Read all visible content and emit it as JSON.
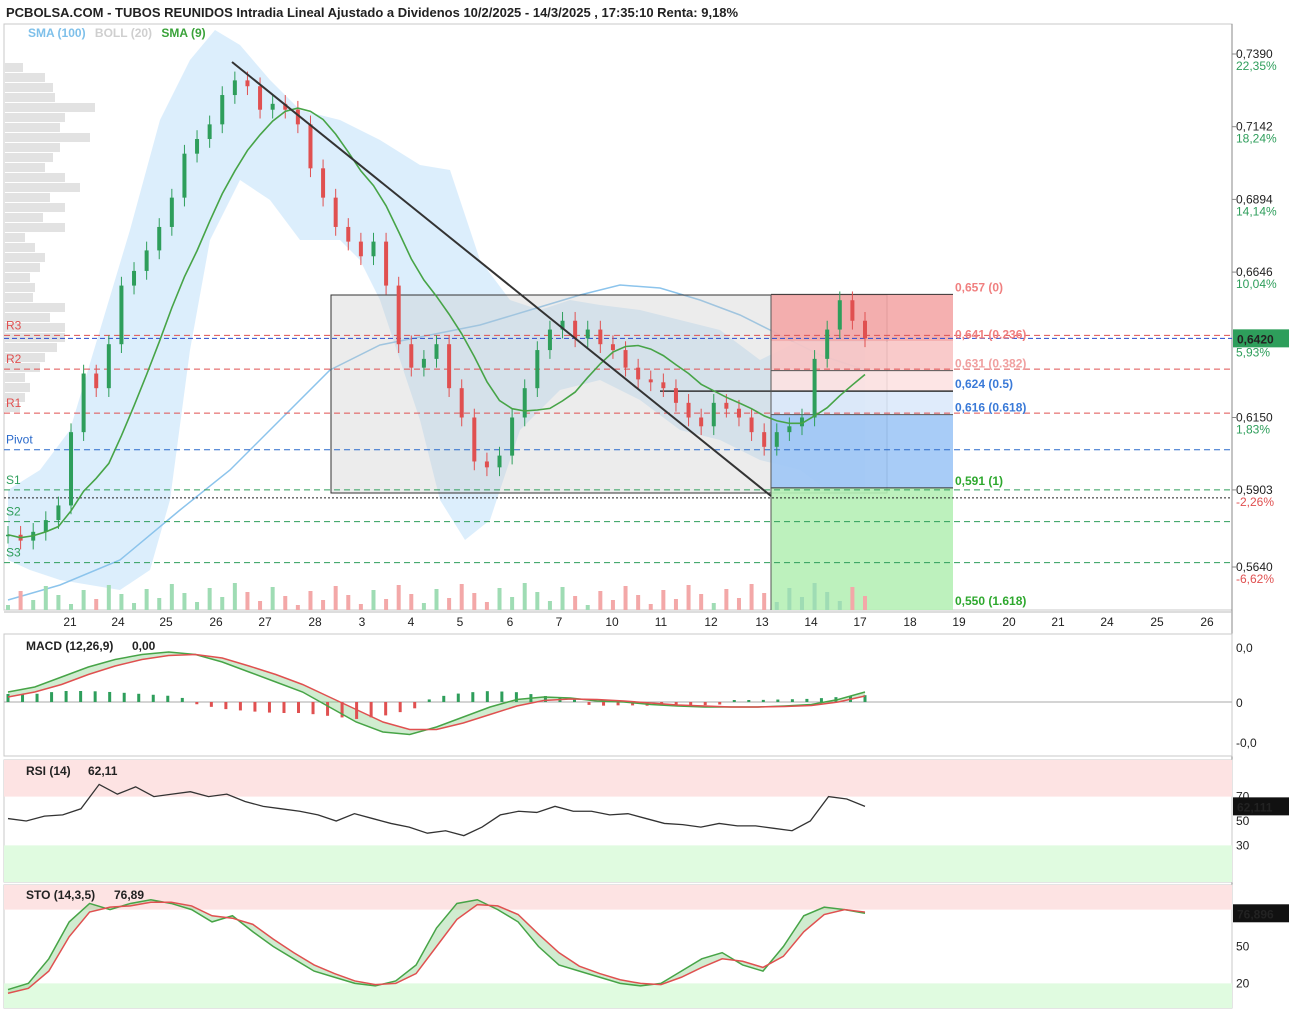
{
  "header": {
    "title": "PCBOLSA.COM - TUBOS REUNIDOS Intradia Lineal Ajustado a Dividenos 10/2/2025 - 14/3/2025 , 17:35:10 Renta: 9,18%"
  },
  "legend": [
    {
      "label": "SMA (100)",
      "color": "#6ab4e8"
    },
    {
      "label": "BOLL (20)",
      "color": "#d8d8d8"
    },
    {
      "label": "SMA (9)",
      "color": "#3aa33a"
    }
  ],
  "colors": {
    "up": "#2e9e5b",
    "down": "#e05050",
    "sma9": "#47a447",
    "sma100": "#8cc4ec",
    "boll_fill": "#d6ebfb",
    "fib_red": "#f4a7a7",
    "fib_blue": "#9ec7f6",
    "fib_green": "#b6f0b6"
  },
  "chart_data": [
    {
      "type": "candlestick",
      "title": "TUBOS REUNIDOS Intradia",
      "x_labels": [
        "21",
        "24",
        "25",
        "26",
        "27",
        "28",
        "3",
        "4",
        "5",
        "6",
        "7",
        "10",
        "11",
        "12",
        "13",
        "14",
        "17",
        "18",
        "19",
        "20",
        "21",
        "24",
        "25",
        "26"
      ],
      "y_ticks": [
        {
          "value": "0,7390",
          "pct": "22,35%"
        },
        {
          "value": "0,7142",
          "pct": "18,24%"
        },
        {
          "value": "0,6894",
          "pct": "14,14%"
        },
        {
          "value": "0,6646",
          "pct": "10,04%"
        },
        {
          "value": "0,6150",
          "pct": "1,83%"
        },
        {
          "value": "0,5903",
          "pct": "-2,26%"
        },
        {
          "value": "0,5640",
          "pct": "-6,62%"
        }
      ],
      "last_price": "0,6420",
      "last_pct": "5,93%",
      "pivots": [
        {
          "label": "R3",
          "value": 0.643
        },
        {
          "label": "R2",
          "value": 0.6315
        },
        {
          "label": "R1",
          "value": 0.6165
        },
        {
          "label": "Pivot",
          "value": 0.604
        },
        {
          "label": "S1",
          "value": 0.5903
        },
        {
          "label": "S2",
          "value": 0.5795
        },
        {
          "label": "S3",
          "value": 0.5655
        }
      ],
      "fibonacci": [
        {
          "label": "0,657 (0)",
          "value": 0.657
        },
        {
          "label": "0,641 (0.236)",
          "value": 0.641
        },
        {
          "label": "0,631 (0.382)",
          "value": 0.631
        },
        {
          "label": "0,624 (0.5)",
          "value": 0.624
        },
        {
          "label": "0,616 (0.618)",
          "value": 0.616
        },
        {
          "label": "0,591 (1)",
          "value": 0.591
        },
        {
          "label": "0,550 (1.618)",
          "value": 0.55
        }
      ],
      "close_series": [
        0.575,
        0.573,
        0.576,
        0.58,
        0.585,
        0.61,
        0.63,
        0.625,
        0.64,
        0.66,
        0.665,
        0.672,
        0.68,
        0.69,
        0.705,
        0.71,
        0.715,
        0.725,
        0.73,
        0.728,
        0.72,
        0.722,
        0.72,
        0.715,
        0.7,
        0.69,
        0.68,
        0.675,
        0.67,
        0.675,
        0.66,
        0.64,
        0.632,
        0.635,
        0.64,
        0.625,
        0.615,
        0.6,
        0.598,
        0.602,
        0.615,
        0.625,
        0.638,
        0.645,
        0.648,
        0.642,
        0.645,
        0.64,
        0.638,
        0.632,
        0.628,
        0.627,
        0.625,
        0.62,
        0.615,
        0.612,
        0.62,
        0.618,
        0.615,
        0.61,
        0.605,
        0.61,
        0.612,
        0.615,
        0.635,
        0.645,
        0.655,
        0.648,
        0.642
      ]
    },
    {
      "type": "line",
      "title": "MACD (12,26,9)",
      "title_value": "0,00",
      "y_ticks": [
        "0,0",
        "0",
        "-0,0"
      ],
      "series": [
        {
          "name": "MACD",
          "values": [
            0.2,
            0.3,
            0.5,
            0.7,
            0.85,
            0.95,
            1.0,
            0.95,
            0.8,
            0.6,
            0.4,
            0.2,
            -0.1,
            -0.4,
            -0.6,
            -0.65,
            -0.5,
            -0.3,
            -0.1,
            0.05,
            0.1,
            0.08,
            0.02,
            0,
            -0.05,
            -0.08,
            -0.1,
            -0.1,
            -0.1,
            -0.08,
            -0.05,
            0.05,
            0.2
          ]
        },
        {
          "name": "Signal",
          "values": [
            0.1,
            0.2,
            0.35,
            0.55,
            0.72,
            0.85,
            0.93,
            0.95,
            0.88,
            0.72,
            0.55,
            0.35,
            0.1,
            -0.15,
            -0.4,
            -0.55,
            -0.55,
            -0.42,
            -0.25,
            -0.08,
            0.03,
            0.06,
            0.05,
            0.02,
            -0.02,
            -0.06,
            -0.08,
            -0.1,
            -0.1,
            -0.09,
            -0.07,
            0,
            0.12
          ]
        }
      ]
    },
    {
      "type": "line",
      "title": "RSI (14)",
      "title_value": "62,11",
      "y_ticks": [
        "70",
        "50",
        "30"
      ],
      "last_value": "62,111",
      "series": [
        {
          "name": "RSI",
          "values": [
            52,
            50,
            54,
            55,
            60,
            80,
            72,
            78,
            70,
            72,
            74,
            70,
            72,
            66,
            62,
            60,
            58,
            55,
            50,
            56,
            52,
            48,
            45,
            40,
            42,
            38,
            45,
            55,
            58,
            57,
            62,
            58,
            58,
            55,
            56,
            52,
            48,
            47,
            45,
            48,
            46,
            46,
            44,
            42,
            50,
            70,
            68,
            62
          ]
        }
      ]
    },
    {
      "type": "line",
      "title": "STO (14,3,5)",
      "title_value": "76,89",
      "y_ticks": [
        "80",
        "50",
        "20"
      ],
      "last_value": "76,896",
      "series": [
        {
          "name": "%K",
          "values": [
            15,
            20,
            40,
            70,
            85,
            80,
            85,
            88,
            85,
            80,
            70,
            75,
            62,
            50,
            40,
            30,
            25,
            20,
            18,
            22,
            35,
            65,
            85,
            88,
            80,
            70,
            50,
            35,
            30,
            25,
            20,
            18,
            20,
            30,
            40,
            45,
            35,
            30,
            50,
            75,
            82,
            80,
            77
          ]
        },
        {
          "name": "%D",
          "values": [
            12,
            16,
            30,
            58,
            78,
            82,
            83,
            86,
            86,
            83,
            75,
            73,
            68,
            56,
            45,
            35,
            28,
            22,
            19,
            20,
            28,
            50,
            72,
            84,
            83,
            76,
            60,
            45,
            34,
            28,
            23,
            20,
            19,
            25,
            33,
            40,
            38,
            33,
            42,
            62,
            76,
            80,
            78
          ]
        }
      ]
    }
  ]
}
